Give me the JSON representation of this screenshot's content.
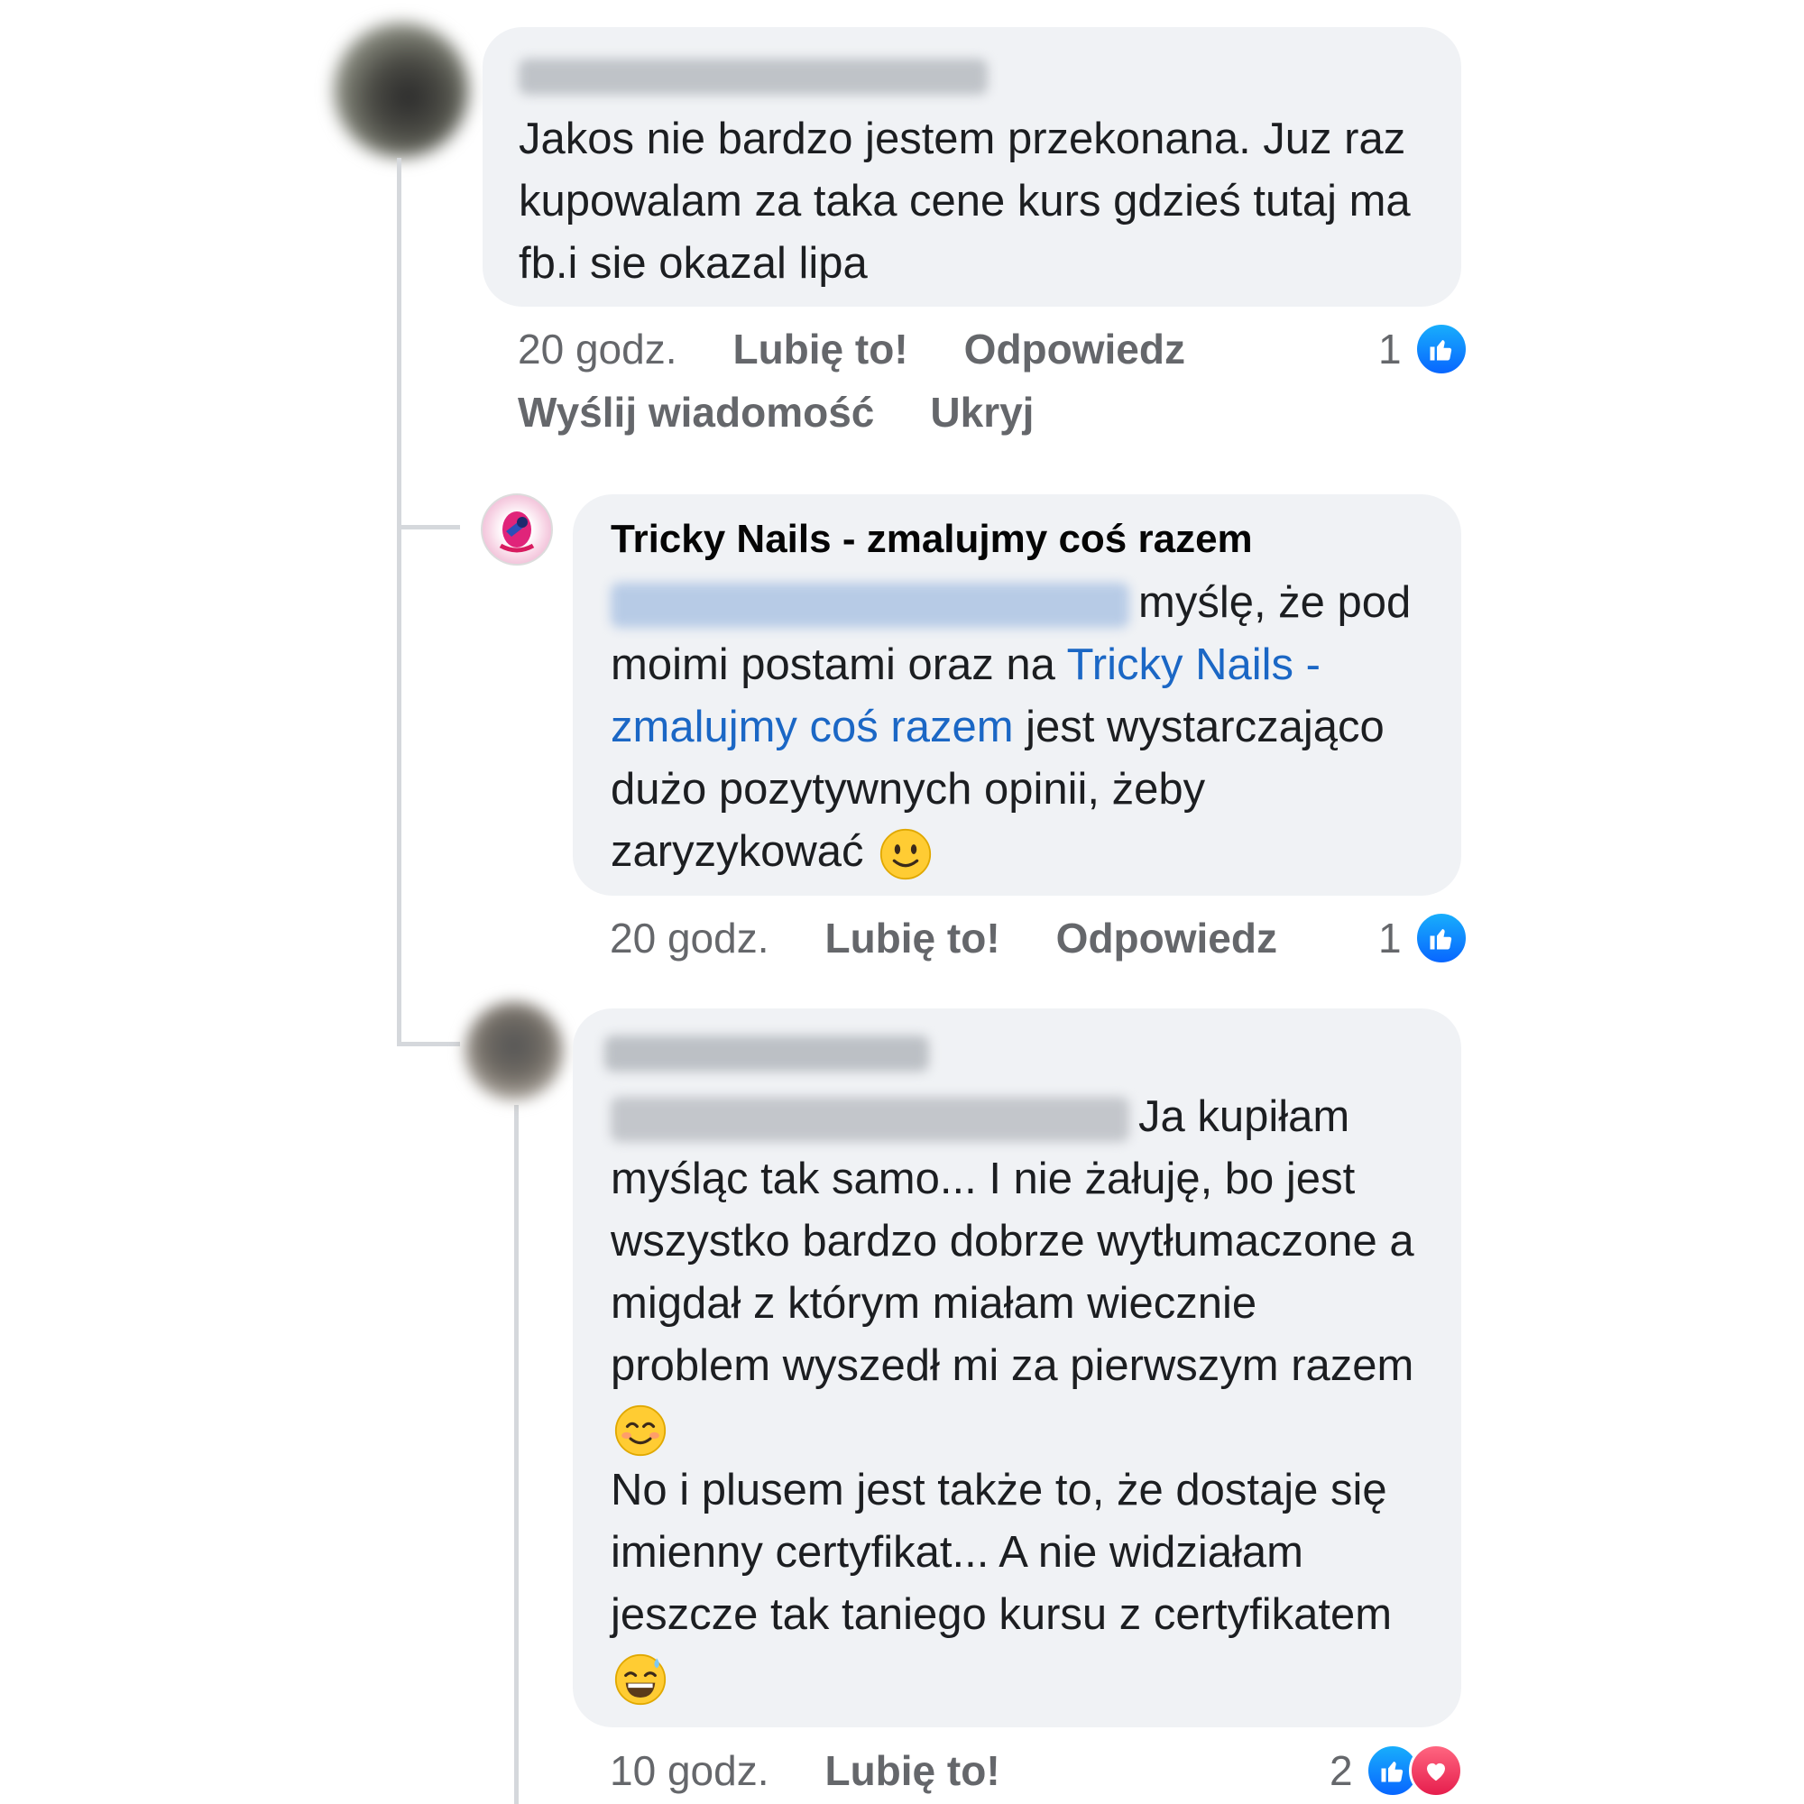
{
  "comment1": {
    "text": "Jakos nie bardzo jestem przekonana. Juz raz kupowalam za taka cene kurs gdzieś tutaj ma fb.i sie okazal lipa",
    "time": "20 godz.",
    "like": "Lubię to!",
    "reply": "Odpowiedz",
    "message": "Wyślij wiadomość",
    "hide": "Ukryj",
    "reaction_count": "1"
  },
  "comment2": {
    "author": "Tricky Nails - zmalujmy coś razem",
    "text_after_mention": "myślę, że pod moimi postami oraz na",
    "page_link": "Tricky Nails - zmalujmy coś razem",
    "text_end": "jest wystarczająco dużo pozytywnych opinii, żeby zaryzykować",
    "emoji": "slightly-smiling-face",
    "time": "20 godz.",
    "like": "Lubię to!",
    "reply": "Odpowiedz",
    "reaction_count": "1"
  },
  "comment3": {
    "text_part1": "Ja kupiłam myśląc tak samo... I nie żałuję, bo jest wszystko bardzo dobrze wytłumaczone a migdał z którym miałam wiecznie problem wyszedł mi za pierwszym razem",
    "emoji1": "smiling-face-with-smiling-eyes",
    "text_part2": "No i plusem jest także to, że dostaje się imienny certyfikat... A nie widziałam jeszcze tak taniego kursu z certyfikatem",
    "emoji2": "grinning-face-with-sweat",
    "time": "10 godz.",
    "like": "Lubię to!",
    "reaction_count": "2"
  },
  "colors": {
    "bubble": "#f0f2f5",
    "meta": "#65676b",
    "link": "#1b67c5",
    "like_blue": "#0866ff",
    "love_red": "#e61e4d"
  }
}
